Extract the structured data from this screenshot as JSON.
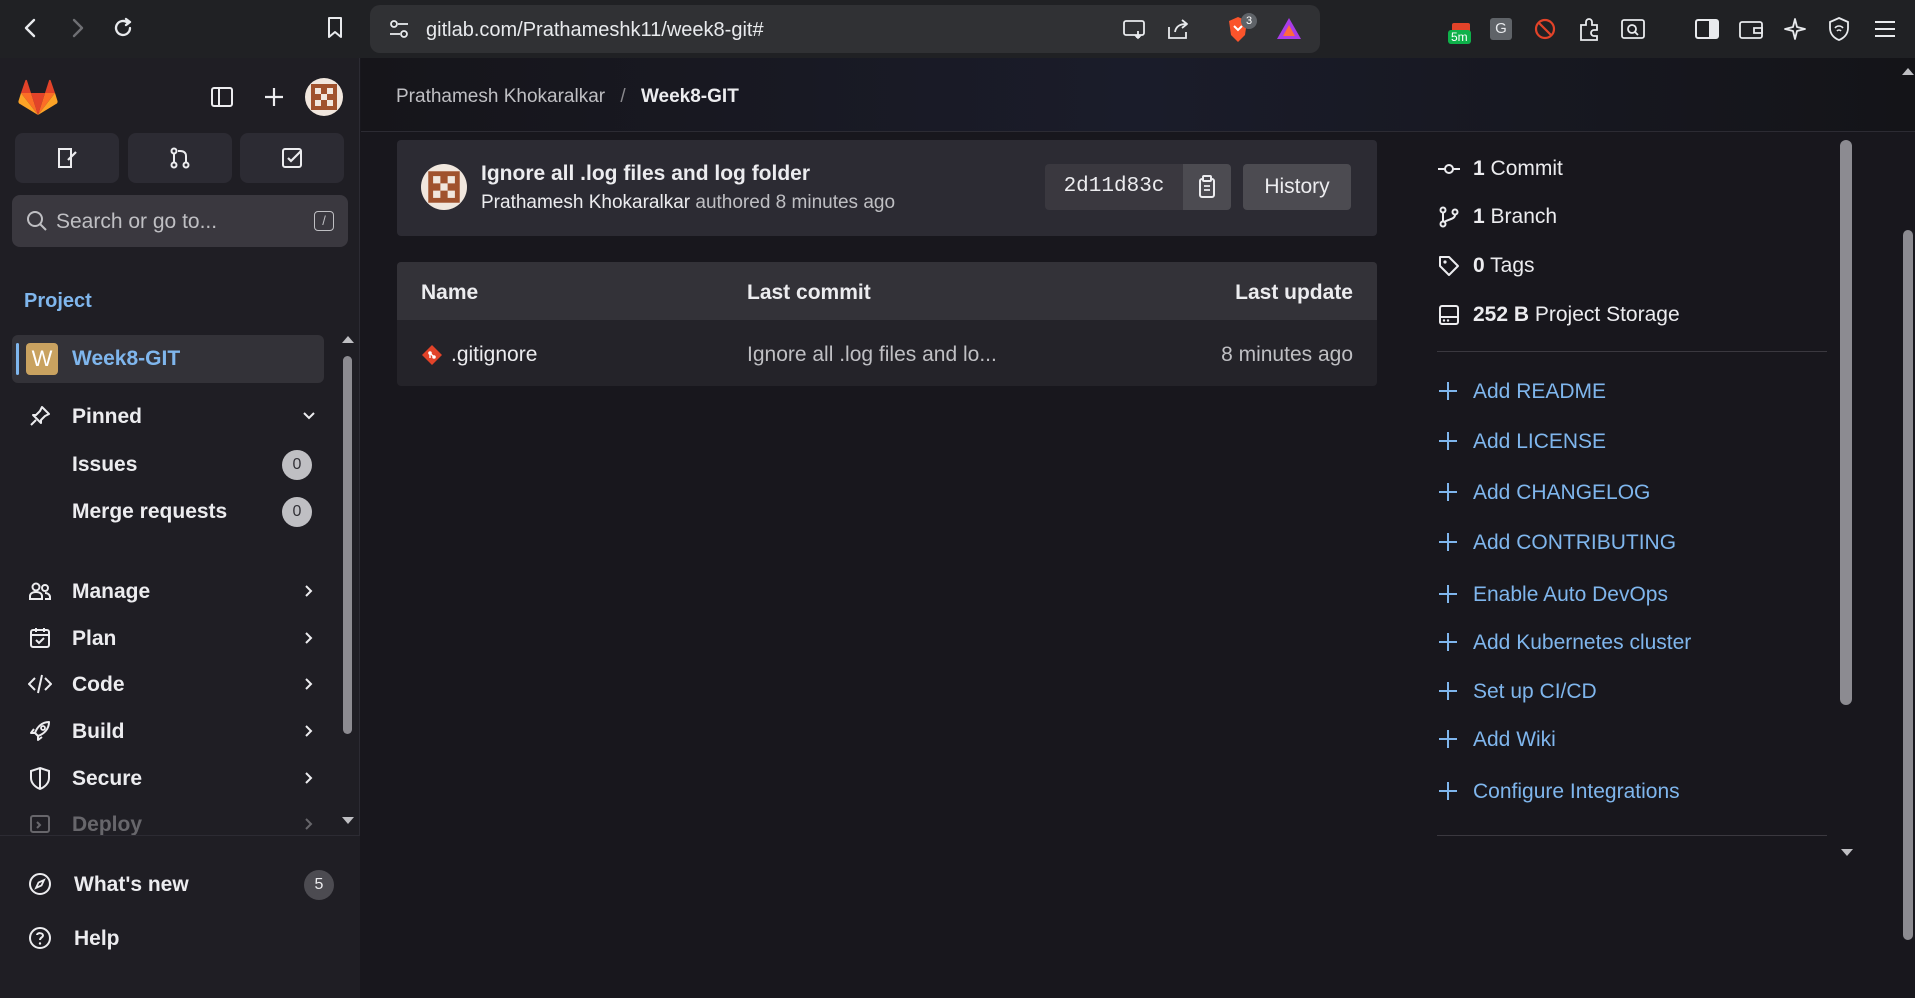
{
  "browser": {
    "url": "gitlab.com/Prathameshk11/week8-git#",
    "brave_badge": "3",
    "ext_timer": "5m",
    "ext_g": "G"
  },
  "sidebar": {
    "search_placeholder": "Search or go to...",
    "search_shortcut": "/",
    "section_label": "Project",
    "project": {
      "avatar_letter": "W",
      "name": "Week8-GIT"
    },
    "pinned": {
      "label": "Pinned",
      "items": [
        {
          "label": "Issues",
          "count": "0"
        },
        {
          "label": "Merge requests",
          "count": "0"
        }
      ]
    },
    "nav": [
      {
        "label": "Manage",
        "icon": "users-icon"
      },
      {
        "label": "Plan",
        "icon": "calendar-icon"
      },
      {
        "label": "Code",
        "icon": "code-icon"
      },
      {
        "label": "Build",
        "icon": "rocket-icon"
      },
      {
        "label": "Secure",
        "icon": "shield-icon"
      },
      {
        "label": "Deploy",
        "icon": "deploy-icon"
      }
    ],
    "bottom": [
      {
        "label": "What's new",
        "count": "5"
      },
      {
        "label": "Help"
      }
    ]
  },
  "breadcrumb": {
    "owner": "Prathamesh Khokaralkar",
    "separator": "/",
    "project": "Week8-GIT"
  },
  "commit": {
    "title": "Ignore all .log files and log folder",
    "author": "Prathamesh Khokaralkar",
    "meta_suffix": " authored 8 minutes ago",
    "sha": "2d11d83c",
    "history_label": "History"
  },
  "files": {
    "headers": {
      "name": "Name",
      "last_commit": "Last commit",
      "last_update": "Last update"
    },
    "rows": [
      {
        "name": ".gitignore",
        "last_commit": "Ignore all .log files and lo...",
        "last_update": "8 minutes ago"
      }
    ]
  },
  "stats": {
    "commits": {
      "count": "1",
      "label": " Commit"
    },
    "branches": {
      "count": "1",
      "label": " Branch"
    },
    "tags": {
      "count": "0",
      "label": " Tags"
    },
    "storage": {
      "count": "252 B",
      "label": " Project Storage"
    }
  },
  "actions": [
    "Add README",
    "Add LICENSE",
    "Add CHANGELOG",
    "Add CONTRIBUTING",
    "Enable Auto DevOps",
    "Add Kubernetes cluster",
    "Set up CI/CD",
    "Add Wiki",
    "Configure Integrations"
  ],
  "colors": {
    "link": "#7fb6ed",
    "gitlab_orange": "#e24329",
    "badge": "#bfbfc3"
  }
}
